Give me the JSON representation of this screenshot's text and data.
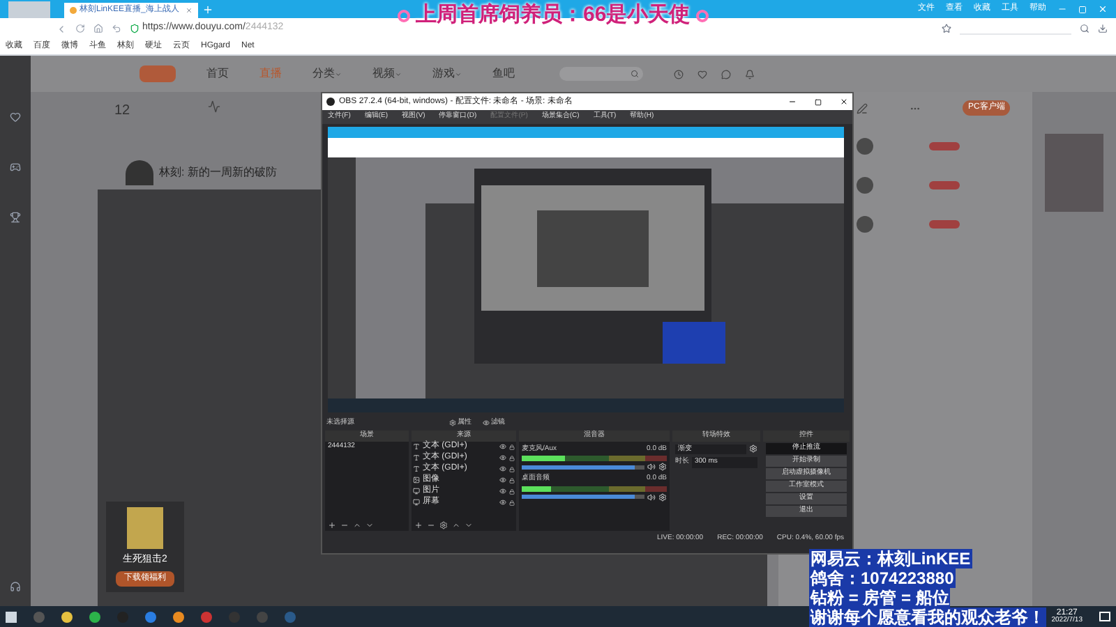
{
  "browser": {
    "tab_title": "林刻LinKEE直播_海上战人",
    "url_host": "https://www.douyu.com/",
    "url_path": "2444132",
    "menu": [
      "文件",
      "查看",
      "收藏",
      "工具",
      "帮助"
    ],
    "bookmarks": [
      "收藏",
      "百度",
      "微博",
      "斗鱼",
      "林刻",
      "硬址",
      "云页",
      "HGgard",
      "Net"
    ]
  },
  "banner": "上周首席饲养员：66是小天使",
  "site": {
    "nav": [
      {
        "label": "首页",
        "selected": false,
        "dropdown": false
      },
      {
        "label": "直播",
        "selected": true,
        "dropdown": false
      },
      {
        "label": "分类",
        "selected": false,
        "dropdown": true
      },
      {
        "label": "视频",
        "selected": false,
        "dropdown": true
      },
      {
        "label": "游戏",
        "selected": false,
        "dropdown": true
      },
      {
        "label": "鱼吧",
        "selected": false,
        "dropdown": false
      }
    ],
    "stat_count": "12",
    "streamer_title": "林刻: 新的一周新的破防",
    "client_button": "PC客户端",
    "promo": {
      "title": "生死狙击2",
      "button": "下载领福利"
    }
  },
  "obs": {
    "title": "OBS 27.2.4 (64-bit, windows) - 配置文件: 未命名 - 场景: 未命名",
    "menu": [
      {
        "label": "文件(F)",
        "disabled": false
      },
      {
        "label": "编辑(E)",
        "disabled": false
      },
      {
        "label": "视图(V)",
        "disabled": false
      },
      {
        "label": "停靠窗口(D)",
        "disabled": false
      },
      {
        "label": "配置文件(P)",
        "disabled": true
      },
      {
        "label": "场景集合(C)",
        "disabled": false
      },
      {
        "label": "工具(T)",
        "disabled": false
      },
      {
        "label": "帮助(H)",
        "disabled": false
      }
    ],
    "no_source": "未选择源",
    "properties": "属性",
    "filters": "滤镜",
    "scenes": {
      "title": "场景",
      "items": [
        {
          "label": "2444132",
          "selected": false
        }
      ]
    },
    "sources": {
      "title": "来源",
      "items": [
        {
          "kind": "text",
          "label": "文本 (GDI+)"
        },
        {
          "kind": "text",
          "label": "文本 (GDI+)"
        },
        {
          "kind": "text",
          "label": "文本 (GDI+)"
        },
        {
          "kind": "image",
          "label": "图像"
        },
        {
          "kind": "capture",
          "label": "图片"
        },
        {
          "kind": "capture",
          "label": "屏幕"
        }
      ]
    },
    "mixer": {
      "title": "混音器",
      "channels": [
        {
          "name": "麦克风/Aux",
          "reading": "0.0 dB",
          "meter": {
            "level": 0.3
          },
          "volume": {
            "level": 0.92
          }
        },
        {
          "name": "桌面音频",
          "reading": "0.0 dB",
          "meter": {
            "level": 0.2
          },
          "volume": {
            "level": 0.92
          }
        }
      ]
    },
    "transitions": {
      "title": "转场特效",
      "effect": "渐变",
      "duration_label": "时长",
      "duration": "300 ms"
    },
    "controls": {
      "title": "控件",
      "buttons": [
        {
          "label": "停止推流",
          "active": true
        },
        {
          "label": "开始录制",
          "active": false
        },
        {
          "label": "启动虚拟摄像机",
          "active": false
        },
        {
          "label": "工作室模式",
          "active": false
        },
        {
          "label": "设置",
          "active": false
        },
        {
          "label": "退出",
          "active": false
        }
      ]
    },
    "status": {
      "live": "LIVE: 00:00:00",
      "rec": "REC: 00:00:00",
      "cpu": "CPU: 0.4%, 60.00 fps"
    }
  },
  "overlay_lines": [
    "网易云：林刻LinKEE",
    "鸽舍：1074223880",
    "钻粉 = 房管 = 船位",
    "谢谢每个愿意看我的观众老爷！"
  ],
  "taskbar": {
    "time": "21:27",
    "date": "2022/7/13"
  }
}
